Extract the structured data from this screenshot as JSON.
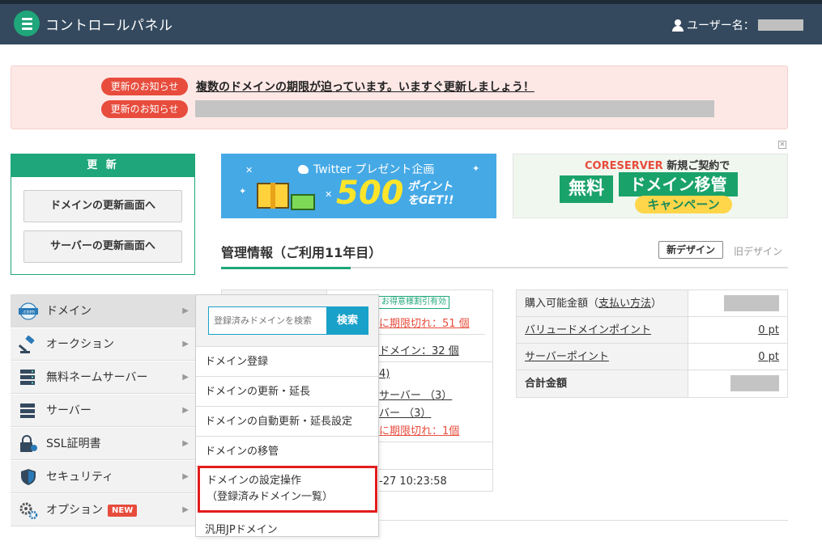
{
  "header": {
    "app_title": "コントロールパネル",
    "user_label": "ユーザー名："
  },
  "alerts": [
    {
      "badge": "更新のお知らせ",
      "text": "複数のドメインの期限が迫っています。いますぐ更新しましょう！"
    },
    {
      "badge": "更新のお知らせ",
      "text": ""
    }
  ],
  "renew": {
    "title": "更 新",
    "domain_btn": "ドメインの更新画面へ",
    "server_btn": "サーバーの更新画面へ"
  },
  "banners": {
    "twitter": {
      "title": "Twitter プレゼント企画",
      "number": "500",
      "points": "ポイント",
      "get": "をGET!!"
    },
    "coreserver": {
      "brand": "CORESERVER",
      "lead": "新規ご契約で",
      "free": "無料",
      "main": "ドメイン移管",
      "campaign": "キャンペーン"
    }
  },
  "management": {
    "title": "管理情報（ご利用11年目）",
    "new_design": "新デザイン",
    "old_design": "旧デザイン"
  },
  "midtable": {
    "discount_tag": "お得意様割引有効",
    "expire_1": "に期限切れ：51 個",
    "domain_count": "ドメイン：32 個",
    "p1": "4)",
    "server_1": "サーバー （3）",
    "server_2": "バー （3）",
    "expire_2": "に期限切れ：1個",
    "datetime": "-27 10:23:58"
  },
  "points": {
    "purchasable_label": "購入可能金額（",
    "payment_link": "支払い方法",
    "purchasable_suffix": "）",
    "value_point_label": "バリュードメインポイント",
    "value_point_val": "0 pt",
    "server_point_label": "サーバーポイント",
    "server_point_val": "0 pt",
    "total_label": "合計金額"
  },
  "side_menu": [
    {
      "label": "ドメイン",
      "icon": "dotcom-icon"
    },
    {
      "label": "オークション",
      "icon": "gavel-icon"
    },
    {
      "label": "無料ネームサーバー",
      "icon": "nameserver-icon"
    },
    {
      "label": "サーバー",
      "icon": "server-icon"
    },
    {
      "label": "SSL証明書",
      "icon": "ssl-lock-icon"
    },
    {
      "label": "セキュリティ",
      "icon": "shield-icon"
    },
    {
      "label": "オプション",
      "icon": "gears-icon",
      "badge": "NEW"
    }
  ],
  "flyout": {
    "search_placeholder": "登録済みドメインを検索",
    "search_btn": "検索",
    "items": [
      "ドメイン登録",
      "ドメインの更新・延長",
      "ドメインの自動更新・延長設定",
      "ドメインの移管"
    ],
    "highlight_line1": "ドメインの設定操作",
    "highlight_line2": "（登録済みドメイン一覧）",
    "last_item": "汎用JPドメイン"
  },
  "colors": {
    "header": "#34495e",
    "accent_green": "#1fa67a",
    "alert_red": "#e74c3c",
    "search_blue": "#1aa1c9"
  }
}
